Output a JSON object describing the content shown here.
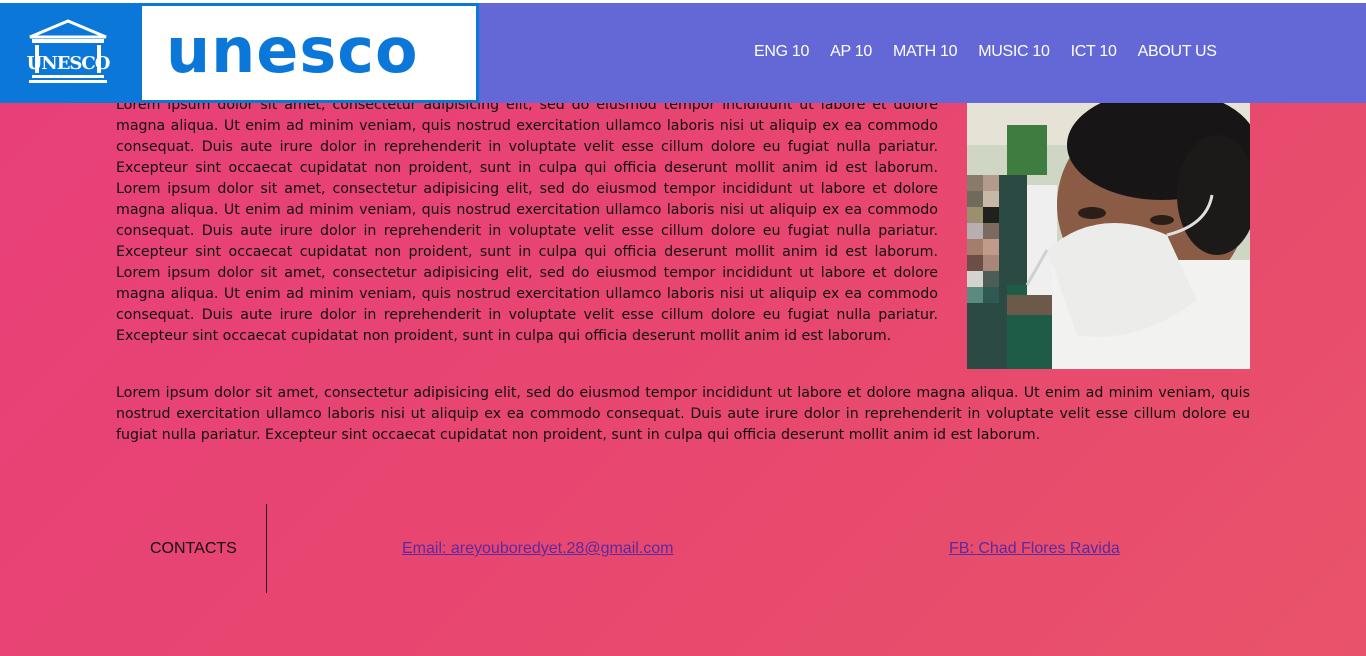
{
  "brand": {
    "emblem_text": "UNESCO",
    "wordmark": "unesco",
    "color": "#0b77d9"
  },
  "nav": {
    "items": [
      {
        "label": "ENG 10"
      },
      {
        "label": "AP 10"
      },
      {
        "label": "MATH 10"
      },
      {
        "label": "MUSIC 10"
      },
      {
        "label": "ICT 10"
      },
      {
        "label": "ABOUT US"
      }
    ]
  },
  "content": {
    "paragraph1": "Lorem ipsum dolor sit amet, consectetur adipisicing elit, sed do eiusmod tempor incididunt ut labore et dolore magna aliqua. Ut enim ad minim veniam, quis nostrud exercitation ullamco laboris nisi ut aliquip ex ea commodo consequat. Duis aute irure dolor in reprehenderit in voluptate velit esse cillum dolore eu fugiat nulla pariatur. Excepteur sint occaecat cupidatat non proident, sunt in culpa qui officia deserunt mollit anim id est laborum. Lorem ipsum dolor sit amet, consectetur adipisicing elit, sed do eiusmod tempor incididunt ut labore et dolore magna aliqua. Ut enim ad minim veniam, quis nostrud exercitation ullamco laboris nisi ut aliquip ex ea commodo consequat. Duis aute irure dolor in reprehenderit in voluptate velit esse cillum dolore eu fugiat nulla pariatur. Excepteur sint occaecat cupidatat non proident, sunt in culpa qui officia deserunt mollit anim id est laborum. Lorem ipsum dolor sit amet, consectetur adipisicing elit, sed do eiusmod tempor incididunt ut labore et dolore magna aliqua. Ut enim ad minim veniam, quis nostrud exercitation ullamco laboris nisi ut aliquip ex ea commodo consequat. Duis aute irure dolor in reprehenderit in voluptate velit esse cillum dolore eu fugiat nulla pariatur. Excepteur sint occaecat cupidatat non proident, sunt in culpa qui officia deserunt mollit anim id est laborum.",
    "paragraph2": "Lorem ipsum dolor sit amet, consectetur adipisicing elit, sed do eiusmod tempor incididunt ut labore et dolore magna aliqua. Ut enim ad minim veniam, quis nostrud exercitation ullamco laboris nisi ut aliquip ex ea commodo consequat. Duis aute irure dolor in reprehenderit in voluptate velit esse cillum dolore eu fugiat nulla pariatur. Excepteur sint occaecat cupidatat non proident, sunt in culpa qui officia deserunt mollit anim id est laborum."
  },
  "footer": {
    "contacts_label": "CONTACTS",
    "email": "Email: areyouboredyet.28@gmail.com",
    "fb": "FB: Chad Flores Ravida"
  },
  "colors": {
    "header_bg": "#6468d6",
    "page_bg_start": "#e83e7a",
    "page_bg_end": "#e9536a",
    "link": "#5b2a9e"
  }
}
